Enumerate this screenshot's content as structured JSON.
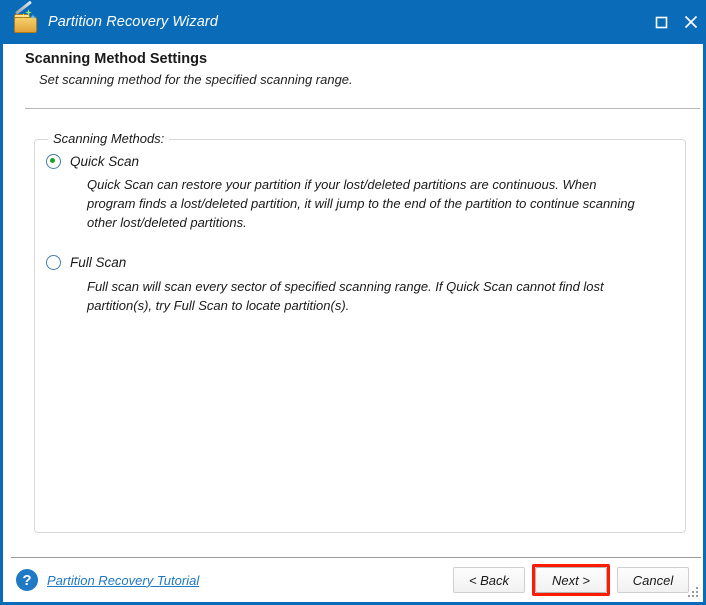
{
  "window": {
    "title": "Partition Recovery Wizard",
    "app_icon": "partition-wizard-icon",
    "controls": {
      "maximize": "maximize-icon",
      "close": "close-icon"
    },
    "accent_color": "#0a6cb8"
  },
  "header": {
    "title": "Scanning Method Settings",
    "subtitle": "Set scanning method for the specified scanning range."
  },
  "group": {
    "legend": "Scanning Methods:"
  },
  "options": [
    {
      "id": "quick-scan",
      "label": "Quick Scan",
      "selected": true,
      "description": "Quick Scan can restore your partition if your lost/deleted partitions are continuous. When program finds a lost/deleted partition, it will jump to the end of the partition to continue scanning other lost/deleted partitions."
    },
    {
      "id": "full-scan",
      "label": "Full Scan",
      "selected": false,
      "description": "Full scan will scan every sector of specified scanning range. If Quick Scan cannot find lost partition(s), try Full Scan to locate partition(s)."
    }
  ],
  "footer": {
    "help_icon": "question-mark-icon",
    "help_link": "Partition Recovery Tutorial",
    "help_link_color": "#1f79c4",
    "buttons": {
      "back": "< Back",
      "next": "Next >",
      "cancel": "Cancel"
    },
    "highlight_color": "#ff1a00"
  }
}
